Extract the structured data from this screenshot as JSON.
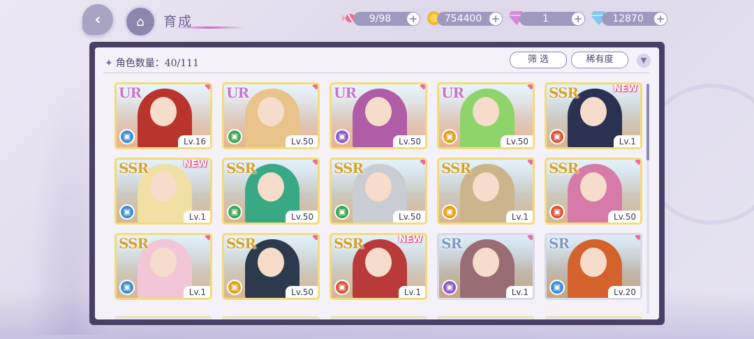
{
  "header": {
    "title": "育成",
    "resources": [
      {
        "name": "candy",
        "icon": "candy-icon",
        "value": "9/98"
      },
      {
        "name": "coin",
        "icon": "coin-icon",
        "value": "754400"
      },
      {
        "name": "pink-gem",
        "icon": "pink-diamond-icon",
        "value": "1"
      },
      {
        "name": "blue-gem",
        "icon": "blue-diamond-icon",
        "value": "12870"
      }
    ]
  },
  "panel": {
    "count_label": "角色数量：40/111",
    "filter_button": "筛 选",
    "rarity_button": "稀有度"
  },
  "colors": {
    "panel_border": "#4a4066",
    "accent": "#8f87b3",
    "new_badge": "#e8467f"
  },
  "cards": [
    {
      "rarity": "UR",
      "level": "Lv.16",
      "element": "blue",
      "new": ""
    },
    {
      "rarity": "UR",
      "level": "Lv.50",
      "element": "green",
      "new": ""
    },
    {
      "rarity": "UR",
      "level": "Lv.50",
      "element": "purple",
      "new": ""
    },
    {
      "rarity": "UR",
      "level": "Lv.50",
      "element": "yellow",
      "new": ""
    },
    {
      "rarity": "SSR",
      "level": "Lv.1",
      "element": "red",
      "new": "NEW"
    },
    {
      "rarity": "SSR",
      "level": "Lv.1",
      "element": "blue",
      "new": "NEW"
    },
    {
      "rarity": "SSR",
      "level": "Lv.50",
      "element": "green",
      "new": ""
    },
    {
      "rarity": "SSR",
      "level": "Lv.50",
      "element": "green",
      "new": ""
    },
    {
      "rarity": "SSR",
      "level": "Lv.1",
      "element": "yellow",
      "new": ""
    },
    {
      "rarity": "SSR",
      "level": "Lv.50",
      "element": "red",
      "new": ""
    },
    {
      "rarity": "SSR",
      "level": "Lv.1",
      "element": "blue",
      "new": ""
    },
    {
      "rarity": "SSR",
      "level": "Lv.50",
      "element": "yellow",
      "new": ""
    },
    {
      "rarity": "SSR",
      "level": "Lv.1",
      "element": "red",
      "new": "NEW"
    },
    {
      "rarity": "SR",
      "level": "Lv.1",
      "element": "purple",
      "new": ""
    },
    {
      "rarity": "SR",
      "level": "Lv.20",
      "element": "blue",
      "new": ""
    }
  ]
}
